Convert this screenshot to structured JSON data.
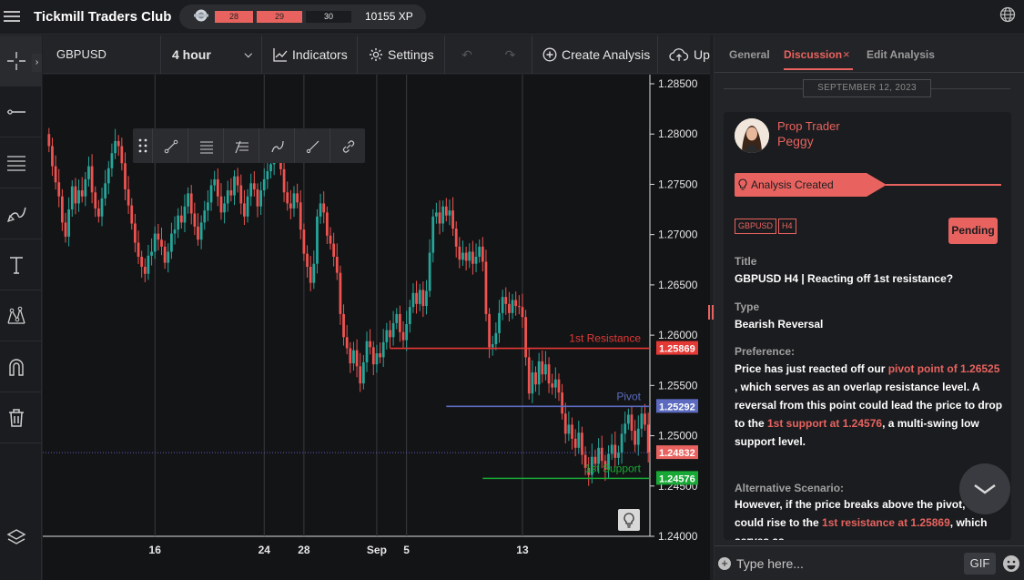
{
  "app": {
    "title": "Tickmill Traders Club",
    "xp_levels": [
      "28",
      "29",
      "30"
    ],
    "xp_total": "10155 XP",
    "xp_progress": 0.9
  },
  "toolbar": {
    "symbol": "GBPUSD",
    "interval": "4 hour",
    "indicators": "Indicators",
    "settings": "Settings",
    "undo": "↶",
    "redo": "↷",
    "create_analysis": "Create Analysis",
    "upload": "Up"
  },
  "left_tools": [
    "crosshair",
    "horizontal-line",
    "parallel-channel",
    "brush",
    "text",
    "pattern",
    "magnet",
    "trash",
    "layers"
  ],
  "chart_data": {
    "type": "candlestick",
    "symbol": "GBPUSD",
    "interval": "4 hour",
    "y_ticks": [
      "1.28500",
      "1.28000",
      "1.27500",
      "1.27000",
      "1.26500",
      "1.26000",
      "1.25500",
      "1.25000",
      "1.24500",
      "1.24000"
    ],
    "ylim": [
      1.24,
      1.285
    ],
    "x_ticks": [
      "16",
      "24",
      "28",
      "Sep",
      "5",
      "13"
    ],
    "colors": {
      "up": "#26a69a",
      "down": "#ef5350"
    },
    "levels": [
      {
        "name": "1st Resistance",
        "value": 1.25869,
        "label": "1.25869",
        "color": "#e53935"
      },
      {
        "name": "Pivot",
        "value": 1.25292,
        "label": "1.25292",
        "color": "#5c6bc0"
      },
      {
        "name": "1st Support",
        "value": 1.24576,
        "label": "1.24576",
        "color": "#18a835"
      }
    ],
    "current_price": {
      "value": 1.24832,
      "label": "1.24832",
      "color": "#e8635f"
    },
    "closes": [
      1.2788,
      1.2768,
      1.2752,
      1.2738,
      1.2712,
      1.2698,
      1.2725,
      1.2748,
      1.2731,
      1.2744,
      1.2738,
      1.2755,
      1.2768,
      1.2742,
      1.2726,
      1.2718,
      1.2736,
      1.2751,
      1.2766,
      1.2781,
      1.2793,
      1.2788,
      1.2771,
      1.2745,
      1.2729,
      1.2711,
      1.2692,
      1.2678,
      1.2668,
      1.2661,
      1.2679,
      1.2683,
      1.2701,
      1.2695,
      1.2688,
      1.2672,
      1.2683,
      1.2701,
      1.2705,
      1.2719,
      1.2712,
      1.2728,
      1.2741,
      1.2721,
      1.2708,
      1.2695,
      1.2712,
      1.2724,
      1.2732,
      1.2749,
      1.2755,
      1.2738,
      1.2722,
      1.2731,
      1.2744,
      1.2739,
      1.2758,
      1.2749,
      1.2731,
      1.2718,
      1.2738,
      1.2751,
      1.2745,
      1.2728,
      1.2744,
      1.2755,
      1.2763,
      1.277,
      1.2788,
      1.2781,
      1.2765,
      1.2742,
      1.2731,
      1.2726,
      1.2741,
      1.2732,
      1.2705,
      1.2681,
      1.2668,
      1.2652,
      1.2671,
      1.2718,
      1.2731,
      1.2722,
      1.2699,
      1.2691,
      1.2678,
      1.2662,
      1.2621,
      1.2598,
      1.2587,
      1.2572,
      1.2585,
      1.2569,
      1.2552,
      1.2573,
      1.2594,
      1.2588,
      1.2571,
      1.2582,
      1.2578,
      1.2593,
      1.2605,
      1.2598,
      1.2612,
      1.2621,
      1.2603,
      1.2595,
      1.2611,
      1.2628,
      1.2642,
      1.2631,
      1.2645,
      1.2629,
      1.2644,
      1.2682,
      1.2718,
      1.2722,
      1.2711,
      1.2728,
      1.2719,
      1.2724,
      1.2706,
      1.2688,
      1.2675,
      1.2682,
      1.2674,
      1.2683,
      1.2671,
      1.2678,
      1.2688,
      1.2673,
      1.2621,
      1.2588,
      1.2591,
      1.2602,
      1.2622,
      1.2638,
      1.2631,
      1.2622,
      1.2635,
      1.2629,
      1.2628,
      1.2618,
      1.2578,
      1.2542,
      1.2563,
      1.2551,
      1.2574,
      1.2561,
      1.2571,
      1.2552,
      1.2548,
      1.2556,
      1.2543,
      1.2522,
      1.2502,
      1.2511,
      1.2497,
      1.2488,
      1.2503,
      1.2481,
      1.2468,
      1.2461,
      1.2479,
      1.2472,
      1.2488,
      1.2475,
      1.2466,
      1.2482,
      1.2491,
      1.2478,
      1.2483,
      1.2502,
      1.2512,
      1.2521,
      1.2505,
      1.2491,
      1.2507,
      1.2522,
      1.2511,
      1.2483
    ]
  },
  "tabs": {
    "general": "General",
    "discussion": "Discussion",
    "close": "×",
    "edit": "Edit Analysis"
  },
  "discussion": {
    "date": "SEPTEMBER 12, 2023",
    "author_role": "Prop Trader",
    "author_name": "Peggy",
    "event": "Analysis Created",
    "tags": [
      "GBPUSD",
      "H4"
    ],
    "status": "Pending",
    "title_label": "Title",
    "title_value": "GBPUSD H4 | Reacting off 1st resistance?",
    "type_label": "Type",
    "type_value": "Bearish Reversal",
    "preference_label": "Preference:",
    "preference": {
      "t1": "Price has just reacted off our ",
      "h1": "pivot point of 1.26525",
      "t2": " , which serves as an overlap resistance level. A reversal from this point could lead the price to drop to the ",
      "h2": "1st support at 1.24576",
      "t3": ", a multi-swing low support level."
    },
    "alt_label": "Alternative Scenario:",
    "alt": {
      "t1": "However, if the price breaks above the pivot, it could rise to the ",
      "h1": "1st resistance at 1.25869",
      "t2": ", which serves as"
    }
  },
  "composer": {
    "placeholder": "Type here...",
    "gif": "GIF"
  }
}
